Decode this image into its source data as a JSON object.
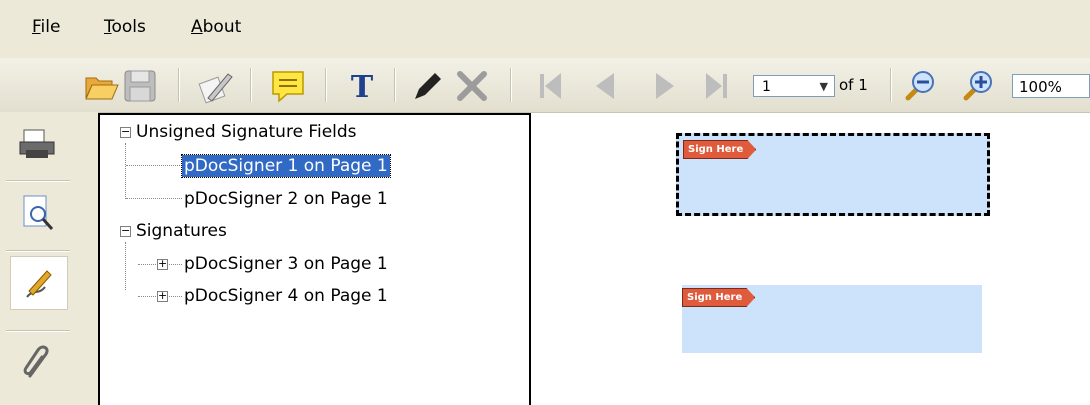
{
  "menu": {
    "file": {
      "accel": "F",
      "rest": "ile"
    },
    "tools": {
      "accel": "T",
      "rest": "ools"
    },
    "about": {
      "accel": "A",
      "rest": "bout"
    }
  },
  "toolbar": {
    "page_value": "1",
    "page_of": "of 1",
    "zoom_value": "100%",
    "buttons": [
      "open-folder-icon",
      "save-icon",
      "sign-pen-icon",
      "comment-icon",
      "text-icon",
      "pencil-icon",
      "delete-icon",
      "first-page-icon",
      "prev-page-icon",
      "next-page-icon",
      "last-page-icon",
      "zoom-out-icon",
      "zoom-in-icon"
    ]
  },
  "sidebar": {
    "buttons": [
      "printer-icon",
      "search-icon",
      "signature-icon",
      "paperclip-icon"
    ],
    "active": "signature-icon"
  },
  "tree": {
    "unsigned_group": "Unsigned Signature Fields",
    "unsigned_items": [
      "pDocSigner 1 on Page 1",
      "pDocSigner 2 on Page 1"
    ],
    "signatures_group": "Signatures",
    "signature_items": [
      "pDocSigner 3 on Page 1",
      "pDocSigner 4 on Page 1"
    ],
    "selected_index": 0
  },
  "document": {
    "fields": [
      {
        "tag": "Sign Here",
        "focused": true
      },
      {
        "tag": "Sign Here",
        "focused": false
      }
    ]
  },
  "colors": {
    "selection": "#316ac5",
    "field_fill": "#cde3fb",
    "tag": "#e05a3c"
  }
}
